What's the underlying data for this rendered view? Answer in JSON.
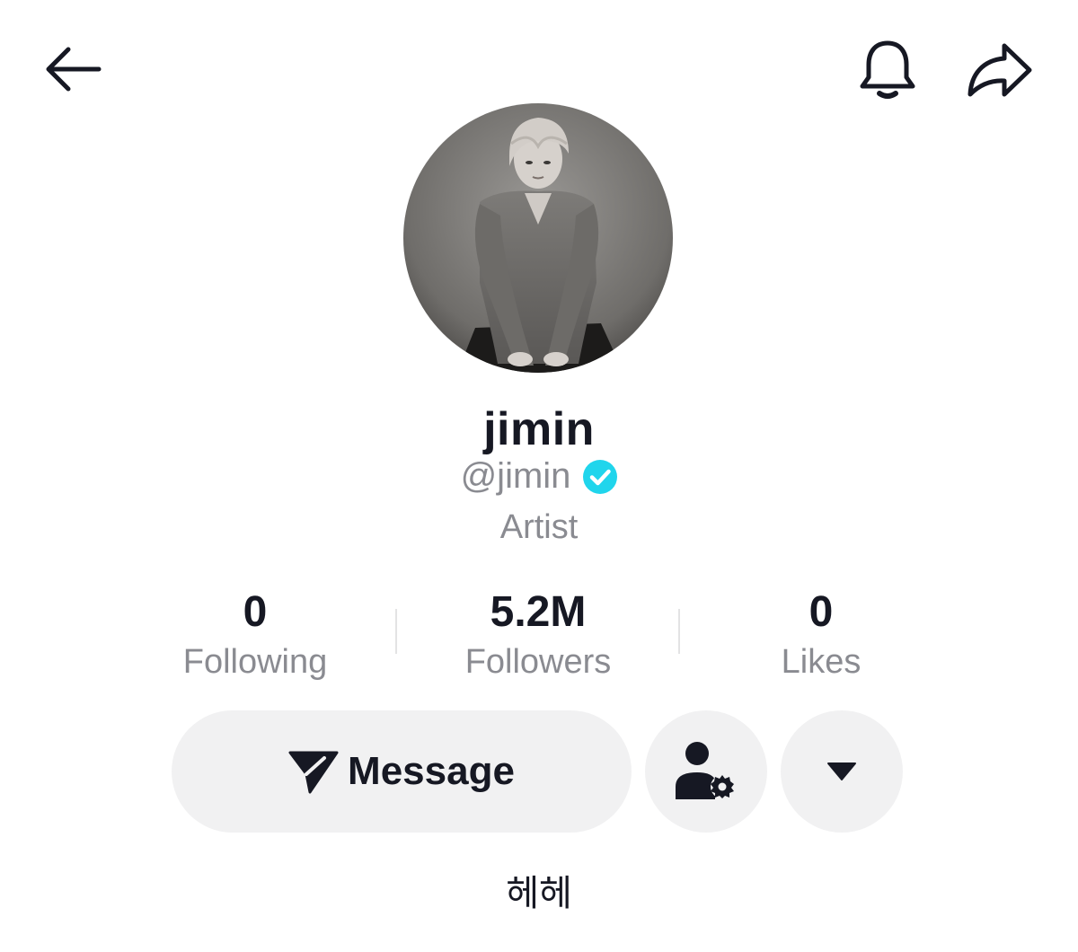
{
  "topbar": {
    "back_icon": "arrow-left-icon",
    "bell_icon": "bell-icon",
    "share_icon": "share-arrow-icon"
  },
  "profile": {
    "display_name": "jimin",
    "handle": "@jimin",
    "verified_icon": "verified-badge-icon",
    "verified_color": "#20d5ec",
    "category": "Artist",
    "bio": "헤헤"
  },
  "stats": [
    {
      "value": "0",
      "label": "Following"
    },
    {
      "value": "5.2M",
      "label": "Followers"
    },
    {
      "value": "0",
      "label": "Likes"
    }
  ],
  "actions": {
    "message_label": "Message",
    "message_icon": "send-icon",
    "friends_icon": "user-settings-icon",
    "more_icon": "caret-down-icon"
  },
  "colors": {
    "text_primary": "#161823",
    "text_secondary": "#8a8b91",
    "button_bg": "#f1f1f2"
  }
}
